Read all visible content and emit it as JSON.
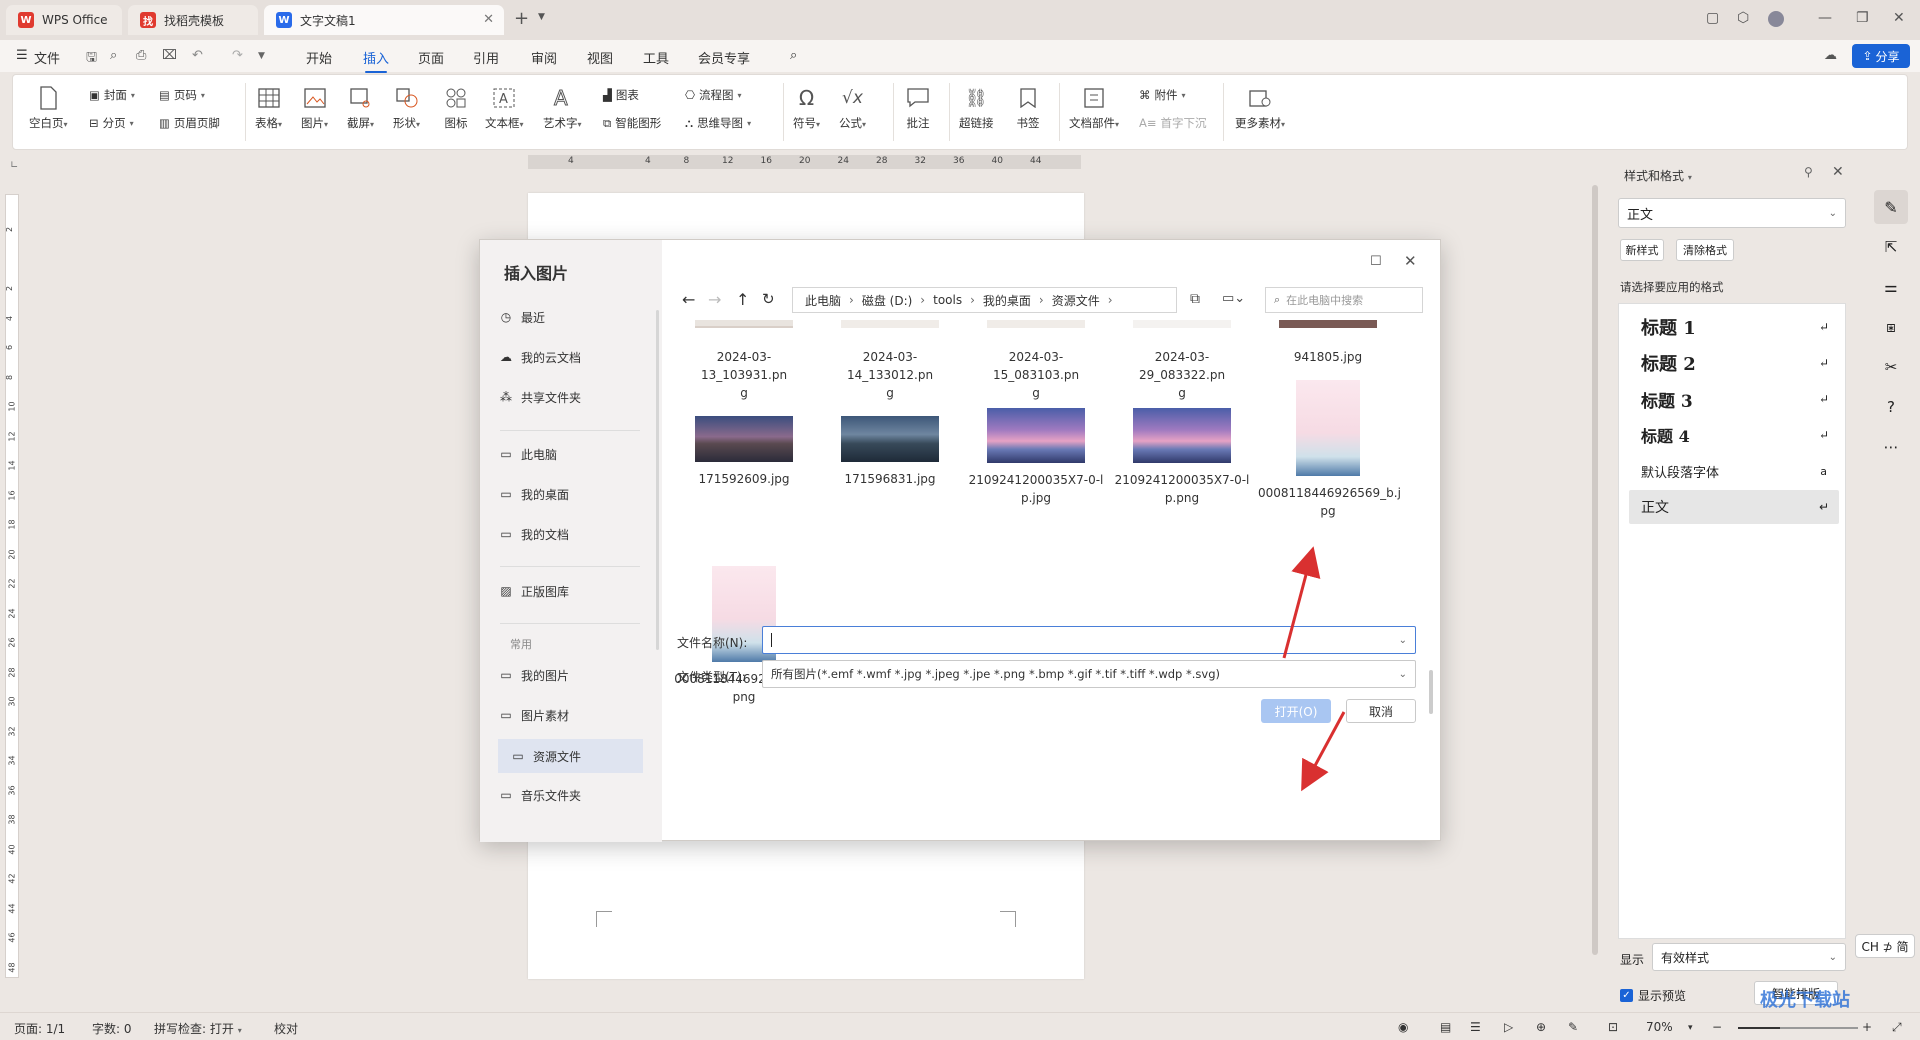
{
  "tabs": [
    {
      "label": "WPS Office",
      "color": "#e03a2f",
      "glyph": "W"
    },
    {
      "label": "找稻壳模板",
      "color": "#e03a2f",
      "glyph": "找"
    },
    {
      "label": "文字文稿1",
      "color": "#2a6bea",
      "glyph": "W"
    }
  ],
  "menu": {
    "file": "文件",
    "items": [
      "开始",
      "插入",
      "页面",
      "引用",
      "审阅",
      "视图",
      "工具",
      "会员专享"
    ],
    "active": "插入",
    "share": "分享"
  },
  "ribbon": {
    "blank_page": "空白页",
    "cover": "封面",
    "page_break": "分页",
    "page_number": "页码",
    "header_footer": "页眉页脚",
    "table": "表格",
    "picture": "图片",
    "screenshot": "截屏",
    "shape": "形状",
    "icon": "图标",
    "textbox": "文本框",
    "wordart": "艺术字",
    "chart": "图表",
    "smart_shape": "智能图形",
    "flowchart": "流程图",
    "mindmap": "思维导图",
    "symbol": "符号",
    "formula": "公式",
    "comment": "批注",
    "hyperlink": "超链接",
    "bookmark": "书签",
    "doc_part": "文档部件",
    "attachment": "附件",
    "drop_cap": "首字下沉",
    "more": "更多素材"
  },
  "ruler": {
    "ticks": [
      "4",
      "",
      "4",
      "8",
      "12",
      "16",
      "20",
      "24",
      "28",
      "32",
      "36",
      "40",
      "44"
    ],
    "vticks": [
      "2",
      "",
      "2",
      "4",
      "6",
      "8",
      "10",
      "12",
      "14",
      "16",
      "18",
      "20",
      "22",
      "24",
      "26",
      "28",
      "30",
      "32",
      "34",
      "36",
      "38",
      "40",
      "42",
      "44",
      "46",
      "48"
    ]
  },
  "styles_panel": {
    "title": "样式和格式",
    "current": "正文",
    "new_style": "新样式",
    "clear_format": "清除格式",
    "prompt": "请选择要应用的格式",
    "items": [
      "标题 1",
      "标题 2",
      "标题 3",
      "标题 4",
      "默认段落字体",
      "正文"
    ],
    "show_label": "显示",
    "show_value": "有效样式",
    "preview": "显示预览",
    "smart": "智能排版"
  },
  "dialog": {
    "title": "插入图片",
    "nav": [
      "最近",
      "我的云文档",
      "共享文件夹",
      "此电脑",
      "我的桌面",
      "我的文档",
      "正版图库",
      "常用",
      "我的图片",
      "图片素材",
      "资源文件",
      "音乐文件夹"
    ],
    "nav_selected": "资源文件",
    "breadcrumb": [
      "此电脑",
      "磁盘 (D:)",
      "tools",
      "我的桌面",
      "资源文件"
    ],
    "search_placeholder": "在此电脑中搜索",
    "files_row1": [
      "2024-03-13_103931.pn\ng",
      "2024-03-14_133012.pn\ng",
      "2024-03-15_083103.pn\ng",
      "2024-03-29_083322.pn\ng",
      "941805.jpg"
    ],
    "files_row2": [
      "171592609.jpg",
      "171596831.jpg",
      "2109241200035X7-0-l\np.jpg",
      "2109241200035X7-0-l\np.png",
      "0008118446926569_b.j\npg"
    ],
    "files_row3": [
      "0008118446926569_b.\npng"
    ],
    "filename_label": "文件名称(N):",
    "filename_value": "",
    "filetype_label": "文件类型(T):",
    "filetype_value": "所有图片(*.emf *.wmf *.jpg *.jpeg *.jpe *.png *.bmp *.gif *.tif *.tiff *.wdp *.svg)",
    "open": "打开(O)",
    "cancel": "取消"
  },
  "status": {
    "page": "页面: 1/1",
    "words": "字数: 0",
    "spell": "拼写检查: 打开",
    "proof": "校对",
    "zoom": "70%"
  },
  "ime": "CH ⊅ 简",
  "watermark": "极光下载站",
  "colors": {
    "accent": "#1a63d6",
    "arrow": "#d93030",
    "open_btn": "#a9c6f2"
  }
}
